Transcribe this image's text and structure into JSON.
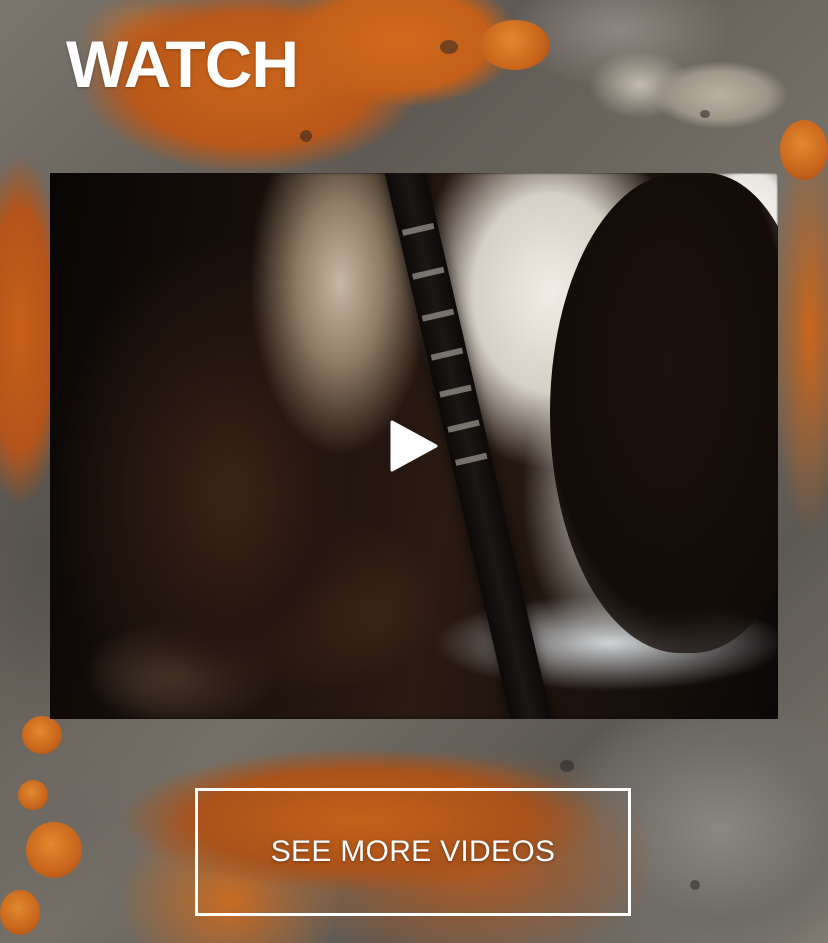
{
  "section": {
    "title": "WATCH"
  },
  "video": {
    "play_icon": "play-icon"
  },
  "cta": {
    "label": "SEE MORE VIDEOS"
  },
  "colors": {
    "text": "#ffffff",
    "lichen_orange": "#c9651c",
    "rock_gray": "#6f6a63",
    "video_bg": "#0d0b0a"
  }
}
